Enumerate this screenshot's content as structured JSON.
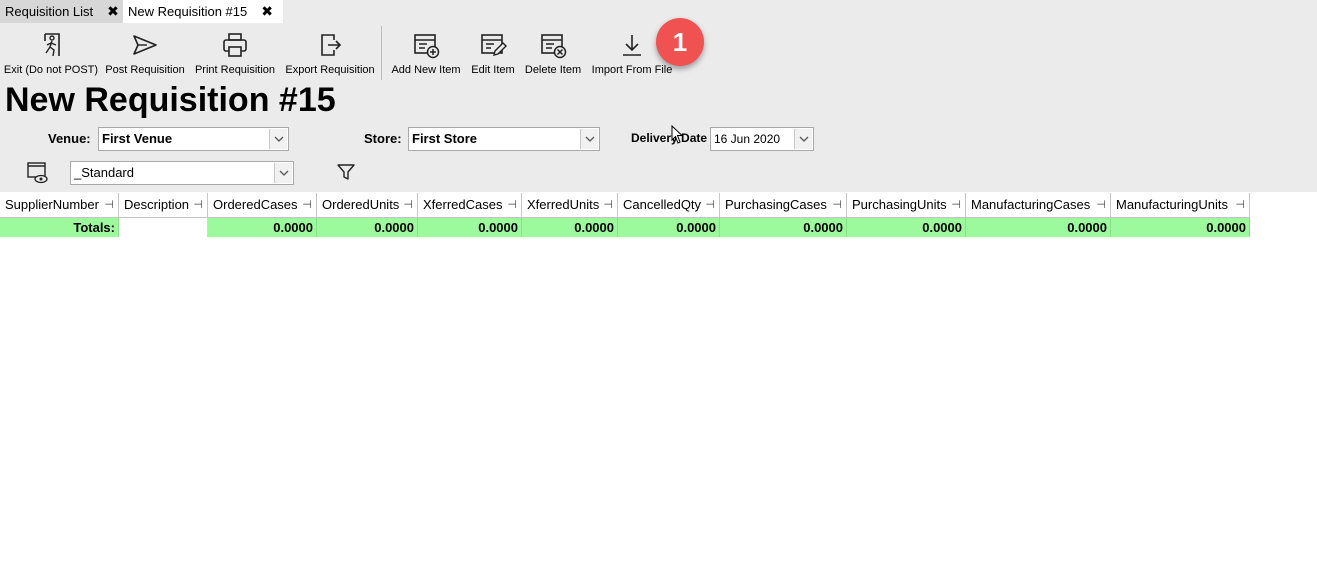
{
  "tabs": [
    {
      "label": "Requisition List",
      "close": "✖"
    },
    {
      "label": "New Requisition #15",
      "close": "✖"
    }
  ],
  "toolbar": {
    "exit": {
      "label": "Exit (Do not POST)",
      "icon": "exit-icon"
    },
    "post": {
      "label": "Post Requisition",
      "icon": "send-icon"
    },
    "print": {
      "label": "Print Requisition",
      "icon": "printer-icon"
    },
    "export": {
      "label": "Export Requisition",
      "icon": "export-icon"
    },
    "add": {
      "label": "Add New Item",
      "icon": "add-item-icon"
    },
    "edit": {
      "label": "Edit Item",
      "icon": "edit-item-icon"
    },
    "delete": {
      "label": "Delete Item",
      "icon": "delete-item-icon"
    },
    "import": {
      "label": "Import From File",
      "icon": "download-icon"
    }
  },
  "badge": "1",
  "page_title": "New Requisition #15",
  "filters": {
    "venue_label": "Venue:",
    "venue_value": "First Venue",
    "store_label": "Store:",
    "store_value": "First Store",
    "delivery_label": "Delivery Date",
    "delivery_value": "16 Jun 2020",
    "layout_value": "_Standard"
  },
  "grid": {
    "columns": [
      "SupplierNumber",
      "Description",
      "OrderedCases",
      "OrderedUnits",
      "XferredCases",
      "XferredUnits",
      "CancelledQty",
      "PurchasingCases",
      "PurchasingUnits",
      "ManufacturingCases",
      "ManufacturingUnits"
    ],
    "pin_glyph": "⊣",
    "totals_label": "Totals:",
    "totals": [
      "",
      "0.0000",
      "0.0000",
      "0.0000",
      "0.0000",
      "0.0000",
      "0.0000",
      "0.0000",
      "0.0000",
      "0.0000"
    ]
  },
  "colors": {
    "toolbar_bg": "#ebebeb",
    "totals_bg": "#9cfa9c",
    "badge": "#f05252"
  }
}
